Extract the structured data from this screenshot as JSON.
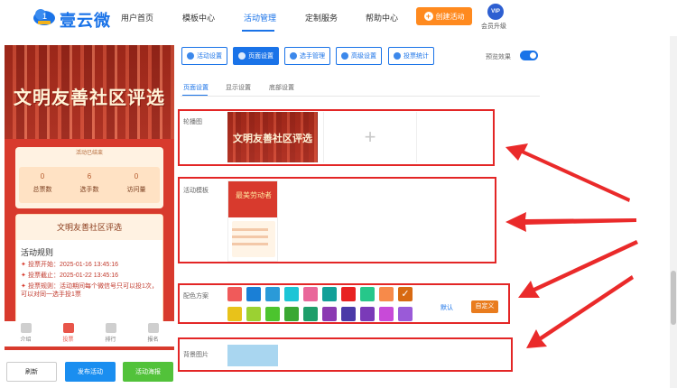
{
  "brand": {
    "name": "壹云微",
    "logo_icon": "cloud-logo-icon"
  },
  "nav": {
    "items": [
      "用户首页",
      "模板中心",
      "活动管理",
      "定制服务",
      "帮助中心"
    ],
    "active": "活动管理",
    "create_button": "创建活动",
    "vip_badge": "VIP",
    "vip_label": "会员升级"
  },
  "preview": {
    "banner_title": "文明友善社区评选",
    "status": "活动已结束",
    "stats": [
      {
        "value": "0",
        "label": "总票数"
      },
      {
        "value": "6",
        "label": "选手数"
      },
      {
        "value": "0",
        "label": "访问量"
      }
    ],
    "info_title": "文明友善社区评选",
    "rules_heading": "活动规则",
    "rules": [
      "投票开始：2025-01-16 13:45:16",
      "投票截止：2025-01-22 13:45:16",
      "投票规则：活动期间每个微信号只可以投1次，可以对同一选手投1票"
    ],
    "tabbar": [
      {
        "label": "介绍",
        "icon": "document-icon"
      },
      {
        "label": "投票",
        "icon": "home-icon"
      },
      {
        "label": "排行",
        "icon": "crown-icon"
      },
      {
        "label": "报名",
        "icon": "person-icon"
      }
    ],
    "active_tab": "投票"
  },
  "actions": {
    "refresh": "刷新",
    "publish": "发布活动",
    "view": "活动海报"
  },
  "toolbar": {
    "buttons": [
      "活动设置",
      "页面设置",
      "选手管理",
      "高级设置",
      "投票统计"
    ],
    "active": "页面设置",
    "preview_effect_label": "预览效果",
    "preview_effect_on": true
  },
  "subtabs": {
    "items": [
      "页面设置",
      "显示设置",
      "底部设置"
    ],
    "active": "页面设置"
  },
  "settings": {
    "carousel_label": "轮播图",
    "carousel_thumb_title": "文明友善社区评选",
    "template_label": "活动模板",
    "template_thumb_title": "最美劳动者",
    "color_label": "配色方案",
    "colors_row1": [
      "#f05a5a",
      "#1a7fd6",
      "#2a9ad8",
      "#1cc5d6",
      "#e9679a",
      "#12a098",
      "#e82222",
      "#26c78a",
      "#f78a4a",
      "#d86a12"
    ],
    "colors_row2": [
      "#e8c21a",
      "#9bd132",
      "#4cc42e",
      "#3aa833",
      "#1e9e6a",
      "#8b3ab2",
      "#4b3aa8",
      "#7a3ab8",
      "#c84ad8",
      "#9a5ad8"
    ],
    "selected_color": "#d86a12",
    "default_label": "默认",
    "custom_label": "自定义",
    "bg_label": "背景图片"
  }
}
